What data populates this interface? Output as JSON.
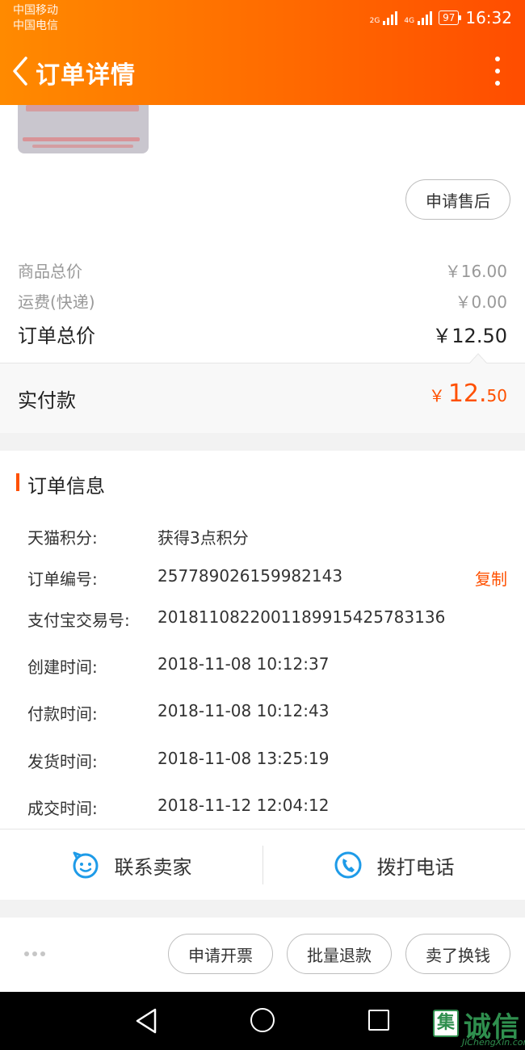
{
  "status_bar": {
    "carrier_1": "中国移动",
    "carrier_2": "中国电信",
    "network_1": "2G",
    "network_2": "4G",
    "battery": "97",
    "time": "16:32"
  },
  "header": {
    "title": "订单详情",
    "back_icon": "chevron-left-icon",
    "more_icon": "more-vertical-icon"
  },
  "product": {
    "after_sales_label": "申请售后"
  },
  "price": {
    "goods_total_label": "商品总价",
    "goods_total_value": "￥16.00",
    "shipping_label": "运费(快递)",
    "shipping_value": "￥0.00",
    "order_total_label": "订单总价",
    "order_total_value": "￥12.50",
    "paid_label": "实付款",
    "paid_currency": "￥",
    "paid_integer": "12.",
    "paid_decimal": "50"
  },
  "order_info": {
    "title": "订单信息",
    "rows": [
      {
        "label": "天猫积分:",
        "value": "获得3点积分"
      },
      {
        "label": "订单编号:",
        "value": "257789026159982143"
      },
      {
        "label": "支付宝交易号:",
        "value": "2018110822001189915425783136"
      },
      {
        "label": "创建时间:",
        "value": "2018-11-08 10:12:37"
      },
      {
        "label": "付款时间:",
        "value": "2018-11-08 10:12:43"
      },
      {
        "label": "发货时间:",
        "value": "2018-11-08 13:25:19"
      },
      {
        "label": "成交时间:",
        "value": "2018-11-12 12:04:12"
      }
    ],
    "copy_label": "复制"
  },
  "contact": {
    "seller_label": "联系卖家",
    "seller_icon": "chat-face-icon",
    "call_label": "拨打电话",
    "call_icon": "phone-icon"
  },
  "actions": {
    "invoice_label": "申请开票",
    "refund_label": "批量退款",
    "resell_label": "卖了换钱"
  },
  "watermark": {
    "logo": "集",
    "text": "诚信",
    "sub": "JiChengXin.com"
  },
  "colors": {
    "accent": "#ff5000",
    "header_start": "#ff8a00",
    "header_end": "#ff4d00",
    "icon_blue": "#1e9be8"
  }
}
